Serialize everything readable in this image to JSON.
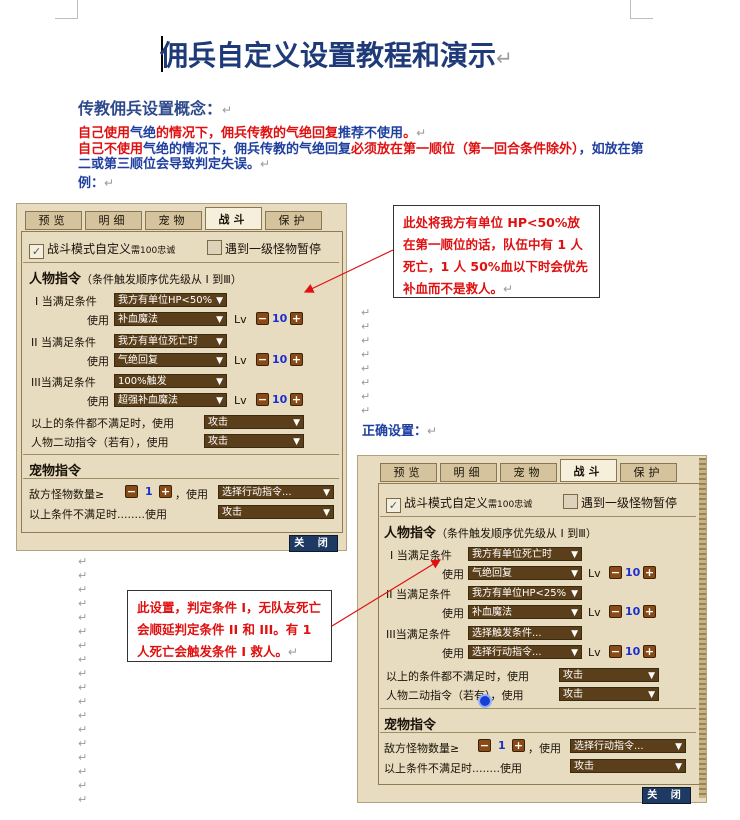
{
  "title": "佣兵自定义设置教程和演示",
  "section_heading": "传教佣兵设置概念：",
  "para1": {
    "a": "自己使用",
    "b": "气绝",
    "c": "的情况下，佣兵传教的气绝回复",
    "d": "推荐不使用",
    "e": "。"
  },
  "para2": {
    "a": "自己不使用",
    "b": "气绝",
    "c": "的情况下，佣兵传教的气绝回复",
    "d": "必须放在第一顺位（第一回合条件除外）",
    "e": "，如放在第二或第三顺位会导致判定失误。"
  },
  "example_label": "例：",
  "correct_label": "正确设置：",
  "return_mark": "↵",
  "note1": "此处将我方有单位 HP<50%放在第一顺位的话，队伍中有 1 人死亡，1 人 50%血以下时会优先补血而不是救人。",
  "note2": "此设置，判定条件 I，无队友死亡会顺延判定条件 II 和 III。有 1 人死亡会触发条件 I 救人。",
  "panel_common": {
    "tabs": [
      "预览",
      "明细",
      "宠物",
      "战斗",
      "保护"
    ],
    "active_tab": "战斗",
    "battle_mode": "战斗模式自定义",
    "loyalty_note": "需100忠诚",
    "pause_label": "遇到一级怪物暂停",
    "char_section": "人物指令",
    "char_section_note": "（条件触发顺序优先级从 I 到Ⅲ）",
    "cond1": "I 当满足条件",
    "cond2": "II 当满足条件",
    "cond3": "III当满足条件",
    "use": "使用",
    "lv": "Lv",
    "fallback": "以上的条件都不满足时，使用",
    "second_cmd": "人物二动指令（若有），使用",
    "pet_section": "宠物指令",
    "enemy_count": "敌方怪物数量≥",
    "enemy_num": "1",
    "enemy_use": "，使用",
    "pet_fallback": "以上条件不满足时........使用",
    "close": "关 闭",
    "minus": "−",
    "plus": "+"
  },
  "panel1": {
    "c1": "我方有单位HP<50%",
    "s1": "补血魔法",
    "lv1": "10",
    "c2": "我方有单位死亡时",
    "s2": "气绝回复",
    "lv2": "10",
    "c3": "100%触发",
    "s3": "超强补血魔法",
    "lv3": "10",
    "fallback_sel": "攻击",
    "second_sel": "攻击",
    "pet_sel": "选择行动指令...",
    "pet_fallback_sel": "攻击"
  },
  "panel2": {
    "c1": "我方有单位死亡时",
    "s1": "气绝回复",
    "lv1": "10",
    "c2": "我方有单位HP<25%",
    "s2": "补血魔法",
    "lv2": "10",
    "c3": "选择触发条件...",
    "s3": "选择行动指令...",
    "lv3": "10",
    "fallback_sel": "攻击",
    "second_sel": "攻击",
    "pet_sel": "选择行动指令...",
    "pet_fallback_sel": "攻击"
  }
}
